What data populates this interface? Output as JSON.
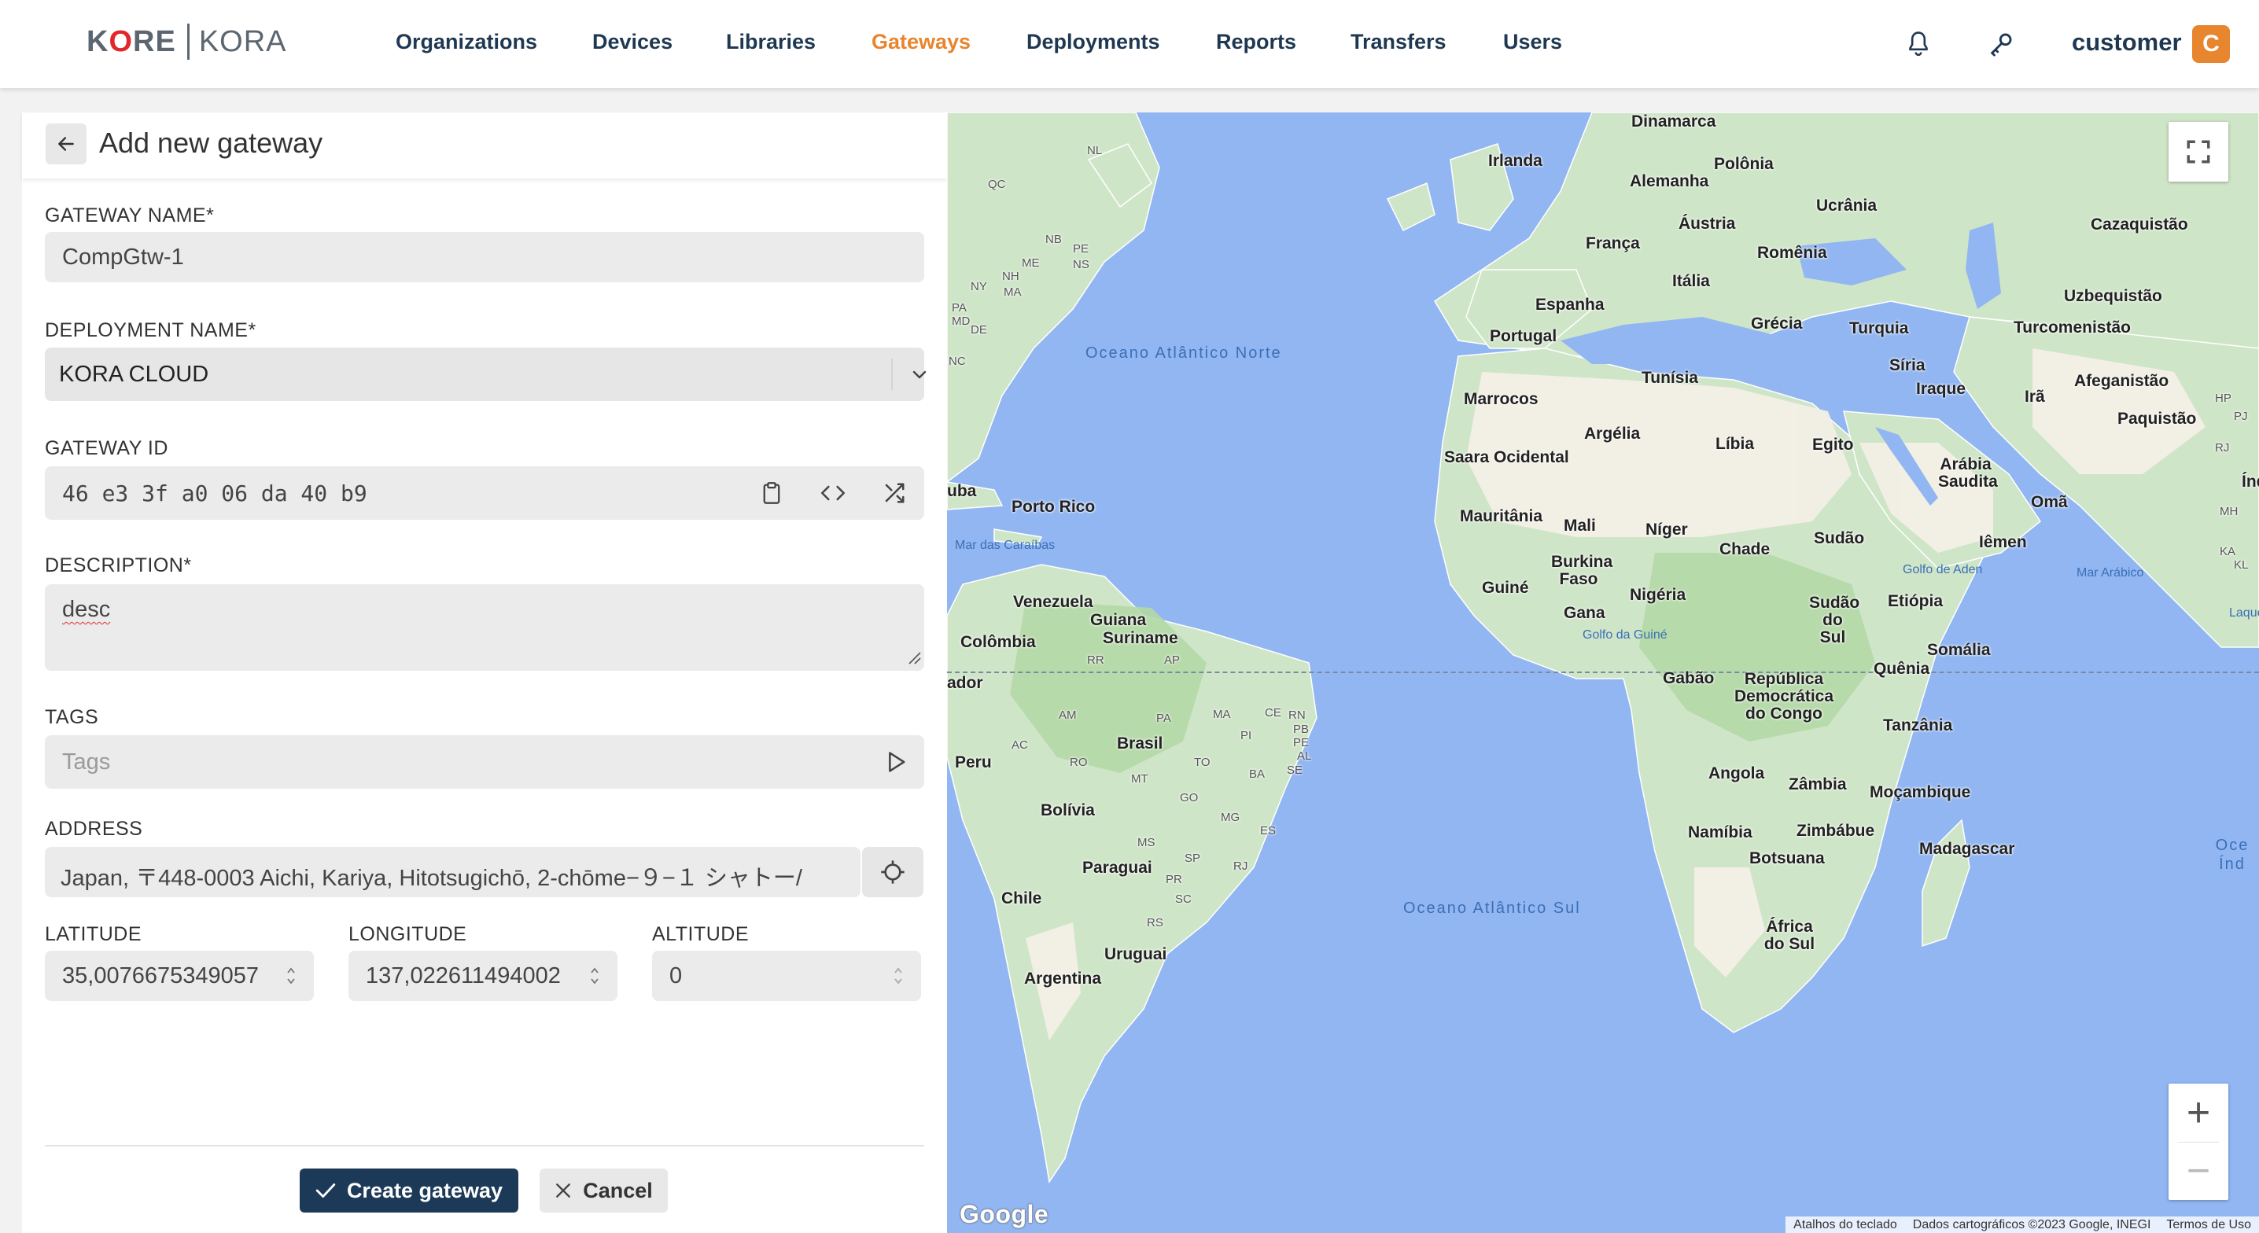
{
  "brand": {
    "logo_left": "KORE",
    "logo_right": "KORA"
  },
  "nav": {
    "items": [
      {
        "label": "Organizations",
        "active": false
      },
      {
        "label": "Devices",
        "active": false
      },
      {
        "label": "Libraries",
        "active": false
      },
      {
        "label": "Gateways",
        "active": true
      },
      {
        "label": "Deployments",
        "active": false
      },
      {
        "label": "Reports",
        "active": false
      },
      {
        "label": "Transfers",
        "active": false
      },
      {
        "label": "Users",
        "active": false
      }
    ],
    "icons": [
      "bell-icon",
      "key-icon"
    ],
    "user_name": "customer",
    "user_initial": "C",
    "accent_color": "#e8852f"
  },
  "form": {
    "title": "Add new gateway",
    "gateway_name": {
      "label": "GATEWAY NAME*",
      "value": "CompGtw-1"
    },
    "deployment_name": {
      "label": "DEPLOYMENT NAME*",
      "value": "KORA CLOUD"
    },
    "gateway_id": {
      "label": "GATEWAY ID",
      "value": "46 e3 3f a0 06 da 40 b9"
    },
    "description": {
      "label": "DESCRIPTION*",
      "value": "desc"
    },
    "tags": {
      "label": "TAGS",
      "placeholder": "Tags"
    },
    "address": {
      "label": "ADDRESS",
      "value": "Japan, 〒448-0003 Aichi, Kariya, Hitotsugichō, 2-chōme−９−１ シャトー/"
    },
    "latitude": {
      "label": "LATITUDE",
      "value": "35,0076675349057"
    },
    "longitude": {
      "label": "LONGITUDE",
      "value": "137,022611494002"
    },
    "altitude": {
      "label": "ALTITUDE",
      "value": "0"
    },
    "create_label": "Create gateway",
    "cancel_label": "Cancel",
    "primary_color": "#1c3a57"
  },
  "map": {
    "countries": [
      "Dinamarca",
      "Irlanda",
      "Polônia",
      "Alemanha",
      "Ucrânia",
      "Áustria",
      "França",
      "Cazaquistão",
      "Romênia",
      "Itália",
      "Espanha",
      "Uzbequistão",
      "Portugal",
      "Grécia",
      "Turquia",
      "Turcomenistão",
      "Tunísia",
      "Síria",
      "Afeganistão",
      "Marrocos",
      "Iraque",
      "Irã",
      "Argélia",
      "Paquistão",
      "Líbia",
      "Egito",
      "Saara Ocidental",
      "Arábia Saudita",
      "Omã",
      "Mauritânia",
      "Mali",
      "Níger",
      "Chade",
      "Sudão",
      "Iêmen",
      "Porto Rico",
      "Burkina Faso",
      "Guiné",
      "Nigéria",
      "Gana",
      "Venezuela",
      "Guiana",
      "Suriname",
      "Sudão do Sul",
      "Etiópia",
      "Colômbia",
      "Somália",
      "Quênia",
      "Gabão",
      "República Democrática do Congo",
      "Peru",
      "Brasil",
      "Tanzânia",
      "Angola",
      "Zâmbia",
      "Moçambique",
      "Bolívia",
      "Namíbia",
      "Zimbábue",
      "Madagascar",
      "Botsuana",
      "Paraguai",
      "Chile",
      "África do Sul",
      "Uruguai",
      "Argentina"
    ],
    "oceans": [
      "Oceano Atlântico Norte",
      "Oceano Atlântico Sul",
      "Mar das Caraíbas",
      "Golfo da Guiné",
      "Golfo de Aden",
      "Mar Arábico"
    ],
    "region_codes": [
      "NL",
      "QC",
      "NB",
      "PE",
      "NS",
      "ME",
      "NH",
      "NY",
      "MA",
      "PA",
      "MD",
      "DE",
      "NC",
      "RR",
      "AP",
      "AM",
      "PA",
      "MA",
      "CE",
      "RN",
      "PB",
      "PE",
      "AL",
      "SE",
      "PI",
      "TO",
      "AC",
      "RO",
      "MT",
      "BA",
      "GO",
      "MG",
      "ES",
      "MS",
      "SP",
      "RJ",
      "PR",
      "SC",
      "RS",
      "HP",
      "PJ",
      "RJ",
      "MH",
      "KA",
      "KL"
    ],
    "edge_labels": [
      "uba",
      "ador",
      "Índ",
      "Laqued",
      "Oce Índ"
    ],
    "zoom_in": "+",
    "zoom_out": "−",
    "google": "Google",
    "attribution": [
      "Atalhos do teclado",
      "Dados cartográficos ©2023 Google, INEGI",
      "Termos de Uso"
    ]
  }
}
